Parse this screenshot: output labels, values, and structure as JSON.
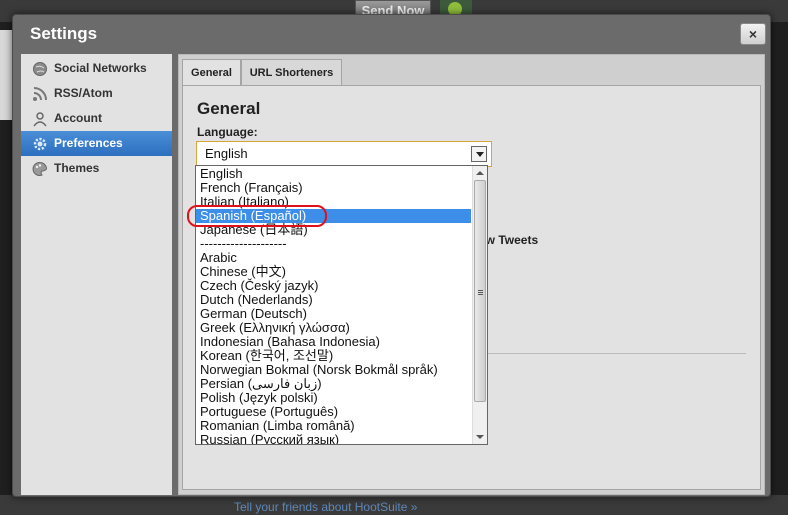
{
  "background": {
    "send_now_label": "Send Now",
    "footer_link": "Tell your friends about HootSuite »",
    "behind_text": "ew Tweets"
  },
  "dialog": {
    "title": "Settings",
    "close_label": "×"
  },
  "sidebar": {
    "items": [
      {
        "label": "Social Networks",
        "icon": "globe-icon",
        "active": false
      },
      {
        "label": "RSS/Atom",
        "icon": "rss-icon",
        "active": false
      },
      {
        "label": "Account",
        "icon": "user-icon",
        "active": false
      },
      {
        "label": "Preferences",
        "icon": "gear-icon",
        "active": true
      },
      {
        "label": "Themes",
        "icon": "palette-icon",
        "active": false
      }
    ]
  },
  "tabs": [
    {
      "label": "General",
      "active": true
    },
    {
      "label": "URL Shorteners",
      "active": false
    }
  ],
  "general": {
    "title": "General",
    "language_label": "Language:",
    "language_value": "English"
  },
  "language_options": [
    "English",
    "French (Français)",
    "Italian (Italiano)",
    "Spanish (Español)",
    "Japanese (日本語)",
    "--------------------",
    "Arabic",
    "Chinese (中文)",
    "Czech (Český jazyk)",
    "Dutch (Nederlands)",
    "German (Deutsch)",
    "Greek (Ελληνική γλώσσα)",
    "Indonesian (Bahasa Indonesia)",
    "Korean (한국어, 조선말)",
    "Norwegian Bokmal (Norsk Bokmål språk)",
    "Persian (زبان فارسی)",
    "Polish (Język polski)",
    "Portuguese (Português)",
    "Romanian (Limba română)",
    "Russian (Русский язык)"
  ],
  "highlighted_option": "Spanish (Español)",
  "colors": {
    "selection": "#3d8ee8",
    "sidebar_active": "#2c6fbf",
    "annotation": "#e0101a"
  }
}
